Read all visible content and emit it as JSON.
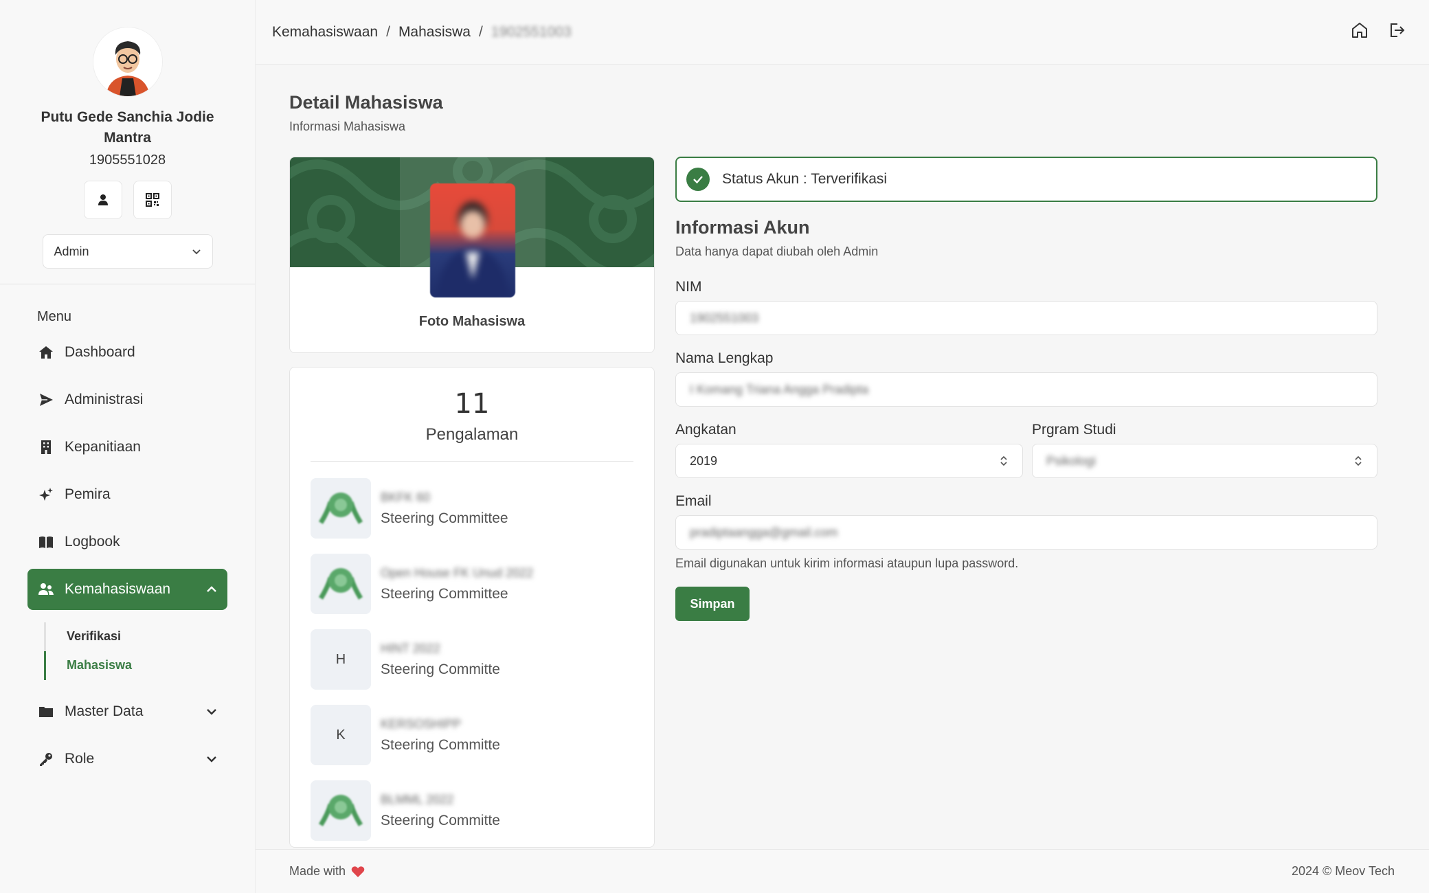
{
  "sidebar": {
    "user_name": "Putu Gede Sanchia Jodie Mantra",
    "user_nim": "1905551028",
    "role": "Admin",
    "menu_title": "Menu",
    "items": [
      {
        "label": "Dashboard"
      },
      {
        "label": "Administrasi"
      },
      {
        "label": "Kepanitiaan"
      },
      {
        "label": "Pemira"
      },
      {
        "label": "Logbook"
      },
      {
        "label": "Kemahasiswaan"
      },
      {
        "label": "Master Data"
      },
      {
        "label": "Role"
      }
    ],
    "submenu": [
      {
        "label": "Verifikasi"
      },
      {
        "label": "Mahasiswa"
      }
    ]
  },
  "header": {
    "breadcrumb": [
      "Kemahasiswaan",
      "Mahasiswa",
      "1902551003"
    ],
    "separator": "/"
  },
  "main": {
    "title": "Detail Mahasiswa",
    "subtitle": "Informasi Mahasiswa",
    "photo_caption": "Foto Mahasiswa",
    "experience": {
      "count": "11",
      "label": "Pengalaman",
      "items": [
        {
          "thumb": "",
          "name": "BKFK 60",
          "role": "Steering Committee"
        },
        {
          "thumb": "",
          "name": "Open House FK Unud 2022",
          "role": "Steering Committee"
        },
        {
          "thumb": "H",
          "name": "HINT 2022",
          "role": "Steering Committe"
        },
        {
          "thumb": "K",
          "name": "KERSOSHIPP",
          "role": "Steering Committe"
        },
        {
          "thumb": "",
          "name": "BLMML 2022",
          "role": "Steering Committe"
        }
      ]
    },
    "status": "Status Akun : Terverifikasi",
    "account": {
      "title": "Informasi Akun",
      "subtitle": "Data hanya dapat diubah oleh Admin",
      "nim_label": "NIM",
      "nim_value": "1902551003",
      "name_label": "Nama Lengkap",
      "name_value": "I Komang Triana Angga Pradipta",
      "angkatan_label": "Angkatan",
      "angkatan_value": "2019",
      "prodi_label": "Prgram Studi",
      "prodi_value": "Psikologi",
      "email_label": "Email",
      "email_value": "pradiptaangga@gmail.com",
      "email_help": "Email digunakan untuk kirim informasi ataupun lupa password.",
      "save_label": "Simpan"
    }
  },
  "footer": {
    "made": "Made with",
    "copyright": "2024 © Meov Tech"
  },
  "colors": {
    "accent": "#3a7d44",
    "banner": "#2f5e3d",
    "heart": "#e0454b"
  },
  "icons": {
    "header": [
      "home-icon",
      "logout-icon"
    ],
    "profile": [
      "user-icon",
      "qr-code-icon"
    ],
    "menu": [
      "home-icon",
      "send-icon",
      "building-icon",
      "sparkles-icon",
      "book-icon",
      "users-icon",
      "folder-icon",
      "key-icon"
    ]
  }
}
